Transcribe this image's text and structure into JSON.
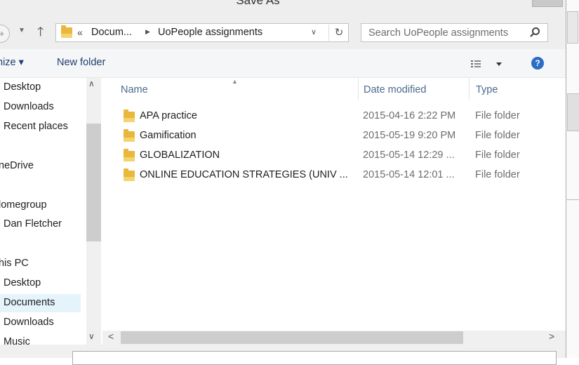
{
  "window": {
    "title": "Save As"
  },
  "address": {
    "overflow_chevrons": "«",
    "crumbs": [
      "Docum...",
      "UoPeople assignments"
    ]
  },
  "search": {
    "placeholder": "Search UoPeople assignments"
  },
  "toolbar": {
    "organize_label": "nize ▾",
    "new_folder_label": "New folder"
  },
  "nav_pane": {
    "items": [
      {
        "label": "Desktop"
      },
      {
        "label": "Downloads"
      },
      {
        "label": "Recent places"
      },
      {
        "label": "neDrive"
      },
      {
        "label": "lomegroup"
      },
      {
        "label": "Dan Fletcher"
      },
      {
        "label": "his PC"
      },
      {
        "label": "Desktop"
      },
      {
        "label": "Documents",
        "selected": true
      },
      {
        "label": "Downloads"
      },
      {
        "label": "Music"
      }
    ]
  },
  "file_list": {
    "columns": {
      "name": "Name",
      "date_modified": "Date modified",
      "type": "Type"
    },
    "rows": [
      {
        "name": "APA practice",
        "date": "2015-04-16 2:22 PM",
        "type": "File folder"
      },
      {
        "name": "Gamification",
        "date": "2015-05-19 9:20 PM",
        "type": "File folder"
      },
      {
        "name": "GLOBALIZATION",
        "date": "2015-05-14 12:29 ...",
        "type": "File folder"
      },
      {
        "name": "ONLINE EDUCATION STRATEGIES (UNIV ...",
        "date": "2015-05-14 12:01 ...",
        "type": "File folder"
      }
    ]
  },
  "colors": {
    "accent": "#2b6cc4",
    "folder": "#e8b73b",
    "link_text": "#1e3f6e",
    "selection": "#e5f3fb"
  }
}
